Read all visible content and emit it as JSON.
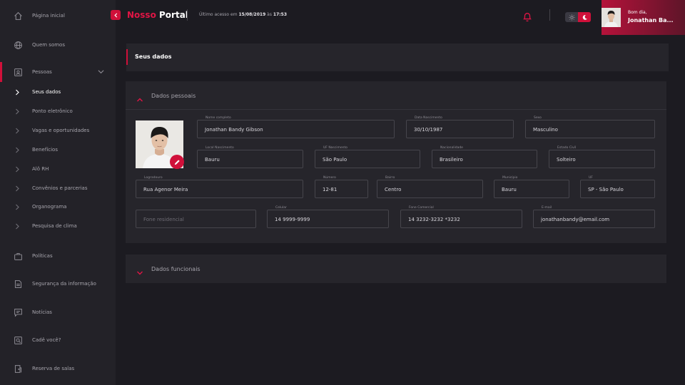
{
  "sidebar": {
    "items": [
      {
        "label": "Página inicial",
        "icon": "home-icon"
      },
      {
        "label": "Quem somos",
        "icon": "globe-icon"
      },
      {
        "label": "Pessoas",
        "icon": "id-badge-icon"
      },
      {
        "label": "Políticas",
        "icon": "briefcase-icon"
      },
      {
        "label": "Segurança da informação",
        "icon": "document-icon"
      },
      {
        "label": "Notícias",
        "icon": "chat-icon"
      },
      {
        "label": "Cadê você?",
        "icon": "search-icon"
      },
      {
        "label": "Reserva de salas",
        "icon": "door-icon"
      }
    ],
    "subitems": [
      {
        "label": "Seus dados"
      },
      {
        "label": "Ponto eletrônico"
      },
      {
        "label": "Vagas e oportunidades"
      },
      {
        "label": "Benefícios"
      },
      {
        "label": "Alô RH"
      },
      {
        "label": "Convênios e parcerias"
      },
      {
        "label": "Organograma"
      },
      {
        "label": "Pesquisa de clima"
      }
    ]
  },
  "header": {
    "brand_part1": "Nosso",
    "brand_part2": "Portal",
    "last_access_prefix": "Último acesso em",
    "last_access_date": "15/08/2019",
    "last_access_sep": "às",
    "last_access_time": "17:53",
    "greeting": "Bom dia,",
    "user_name": "Jonathan Ba..."
  },
  "page": {
    "title": "Seus dados"
  },
  "personal": {
    "title": "Dados pessoais",
    "fields": [
      {
        "label": "Nome completo",
        "value": "Jonathan Bandy Gibson"
      },
      {
        "label": "Data Nascimento",
        "value": "30/10/1987"
      },
      {
        "label": "Sexo",
        "value": "Masculino"
      },
      {
        "label": "Local Nascimento",
        "value": "Bauru"
      },
      {
        "label": "UF Nascimento",
        "value": "São Paulo"
      },
      {
        "label": "Nacionalidade",
        "value": "Brasileiro"
      },
      {
        "label": "Estado Civil",
        "value": "Solteiro"
      },
      {
        "label": "Logradouro",
        "value": "Rua Agenor Meira"
      },
      {
        "label": "Número",
        "value": "12-81"
      },
      {
        "label": "Bairro",
        "value": "Centro"
      },
      {
        "label": "Município",
        "value": "Bauru"
      },
      {
        "label": "UF",
        "value": "SP - São Paulo"
      },
      {
        "label": "",
        "placeholder": "Fone residencial"
      },
      {
        "label": "Celular",
        "value": "14 9999-9999"
      },
      {
        "label": "Fone Comercial",
        "value": "14 3232-3232 *3232"
      },
      {
        "label": "E-mail",
        "value": "jonathanbandy@email.com"
      }
    ]
  },
  "functional": {
    "title": "Dados funcionais"
  },
  "colors": {
    "accent": "#d0103a",
    "background": "#1c1b21",
    "sidebar": "#232228",
    "panel": "#26252b"
  }
}
